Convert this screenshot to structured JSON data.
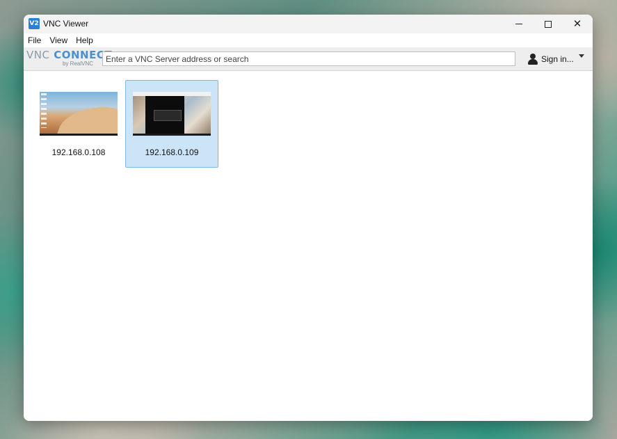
{
  "window": {
    "title": "VNC Viewer",
    "app_icon_text": "V2"
  },
  "menu": {
    "items": [
      {
        "label": "File"
      },
      {
        "label": "View"
      },
      {
        "label": "Help"
      }
    ]
  },
  "toolbar": {
    "logo_vnc": "VNC",
    "logo_connect": "CONNECT",
    "logo_sub": "by RealVNC",
    "search_placeholder": "Enter a VNC Server address or search",
    "signin_label": "Sign in..."
  },
  "connections": [
    {
      "label": "192.168.0.108",
      "selected": false,
      "thumbnail": "desert-desktop"
    },
    {
      "label": "192.168.0.109",
      "selected": true,
      "thumbnail": "architecture-desktop"
    }
  ],
  "colors": {
    "selection_bg": "#cce4f7",
    "selection_border": "#7cb8e6",
    "brand_blue": "#4a90cf"
  }
}
